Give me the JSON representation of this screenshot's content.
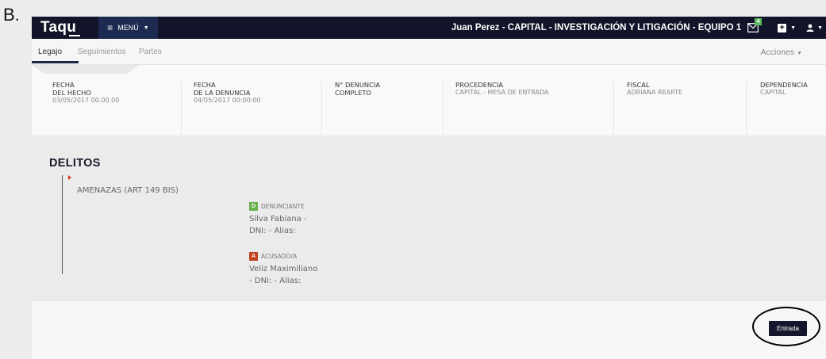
{
  "outer_label": "B.",
  "navbar": {
    "logo": "Taqu",
    "menu_label": "MENÚ",
    "user_title": "Juan Perez - CAPITAL - INVESTIGACIÓN Y LITIGACIÓN - EQUIPO 1",
    "notification_count": "4",
    "icons": [
      "menu-bars-icon",
      "mail-icon",
      "plus-square-icon",
      "user-icon"
    ],
    "colors": {
      "navbar_bg": "#121429",
      "menu_bg": "#1d2a52",
      "badge_green": "#5cb85c"
    }
  },
  "tabs": [
    {
      "label": "Legajo",
      "active": true
    },
    {
      "label": "Seguimientos",
      "active": false
    },
    {
      "label": "Partes",
      "active": false
    }
  ],
  "acciones_label": "Acciones",
  "info": [
    {
      "label": "FECHA DEL HECHO",
      "value": "03/05/2017 00.00.00"
    },
    {
      "label": "FECHA DE LA DENUNCIA",
      "value": "04/05/2017 00:00:00"
    },
    {
      "label": "N° DENUNCIA COMPLETO",
      "value": ""
    },
    {
      "label": "PROCEDENCIA",
      "value": "CAPITAL - MESA DE ENTRADA"
    },
    {
      "label": "FISCAL",
      "value": "ADRIANA REARTE"
    },
    {
      "label": "DEPENDENCIA",
      "value": "CAPITAL"
    }
  ],
  "delitos": {
    "title": "DELITOS",
    "items": [
      {
        "name": "AMENAZAS (ART 149 BIS)",
        "parties": [
          {
            "badge": "D",
            "badge_color": "#6ab04c",
            "role": "DENUNCIANTE",
            "line1": "Silva Fabiana -",
            "line2": "DNI: - Alias:"
          },
          {
            "badge": "A",
            "badge_color": "#c0431f",
            "role": "ACUSADO/A",
            "line1": "Veliz Maximiliano",
            "line2": "- DNI: - Alias:"
          }
        ]
      }
    ]
  },
  "footer": {
    "entrada_label": "Entrada"
  }
}
